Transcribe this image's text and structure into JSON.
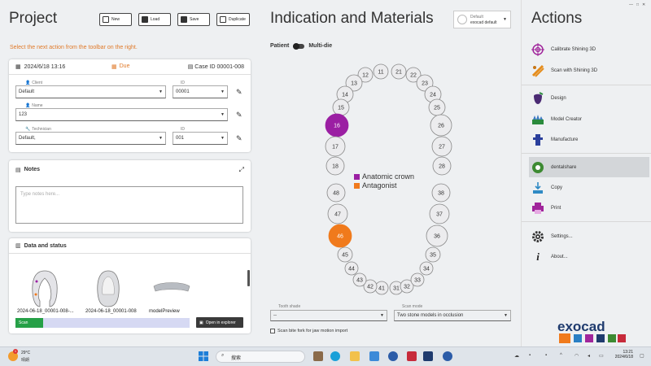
{
  "project": {
    "title": "Project",
    "toolbar": {
      "new": "New",
      "load": "Load",
      "save": "Save",
      "duplicate": "Duplicate"
    },
    "hint": "Select the next action from the toolbar on the right.",
    "date": "2024/6/18 13:16",
    "due": "Due",
    "case_id": "Case ID 00001-008",
    "client": {
      "label": "Client",
      "value": "Default",
      "id_label": "ID",
      "id_value": "00001"
    },
    "name": {
      "label": "Name",
      "value": "123"
    },
    "technician": {
      "label": "Technician",
      "value": "Default,",
      "id_label": "ID",
      "id_value": "001"
    },
    "notes": {
      "title": "Notes",
      "placeholder": "Type notes here..."
    },
    "data": {
      "title": "Data and status",
      "items": [
        {
          "label": "2024-06-18_00001-008-..."
        },
        {
          "label": "2024-06-18_00001-008"
        },
        {
          "label": "modelPreview"
        }
      ],
      "progress_label": "Scan",
      "progress_percent": 16,
      "explorer": "Open in explorer"
    }
  },
  "indication": {
    "title": "Indication and Materials",
    "material": {
      "line1": "Default",
      "line2": "exocad default"
    },
    "patient": "Patient",
    "multi_die": "Multi-die",
    "legend": [
      {
        "label": "Anatomic crown",
        "color": "#9b1fa3"
      },
      {
        "label": "Antagonist",
        "color": "#f07a1c"
      }
    ],
    "upper_teeth": [
      "11",
      "12",
      "13",
      "14",
      "15",
      "16",
      "17",
      "18",
      "21",
      "22",
      "23",
      "24",
      "25",
      "26",
      "27",
      "28"
    ],
    "lower_teeth": [
      "31",
      "32",
      "33",
      "34",
      "35",
      "36",
      "37",
      "38",
      "41",
      "42",
      "43",
      "44",
      "45",
      "46",
      "47",
      "48"
    ],
    "tooth_shade": {
      "label": "Tooth shade",
      "value": "--"
    },
    "scan_mode": {
      "label": "Scan mode",
      "value": "Two stone models in occlusion"
    },
    "scan_bite": "Scan bite fork for jaw motion import"
  },
  "actions": {
    "title": "Actions",
    "items": [
      {
        "label": "Calibrate Shining 3D",
        "icon": "target-icon"
      },
      {
        "label": "Scan with Shining 3D",
        "icon": "scan-icon"
      },
      {
        "label": "Design",
        "icon": "design-icon"
      },
      {
        "label": "Model Creator",
        "icon": "model-creator-icon"
      },
      {
        "label": "Manufacture",
        "icon": "manufacture-icon"
      },
      {
        "label": "dentalshare",
        "icon": "dentalshare-icon"
      },
      {
        "label": "Copy",
        "icon": "copy-icon"
      },
      {
        "label": "Print",
        "icon": "print-icon"
      },
      {
        "label": "Settings...",
        "icon": "gear-icon"
      },
      {
        "label": "About...",
        "icon": "info-icon"
      }
    ],
    "logo": "exocad"
  },
  "taskbar": {
    "temp": "29°C",
    "condition": "晴朗",
    "search": "搜索",
    "time": "13:21",
    "date": "2024/6/18",
    "badge": "1"
  }
}
